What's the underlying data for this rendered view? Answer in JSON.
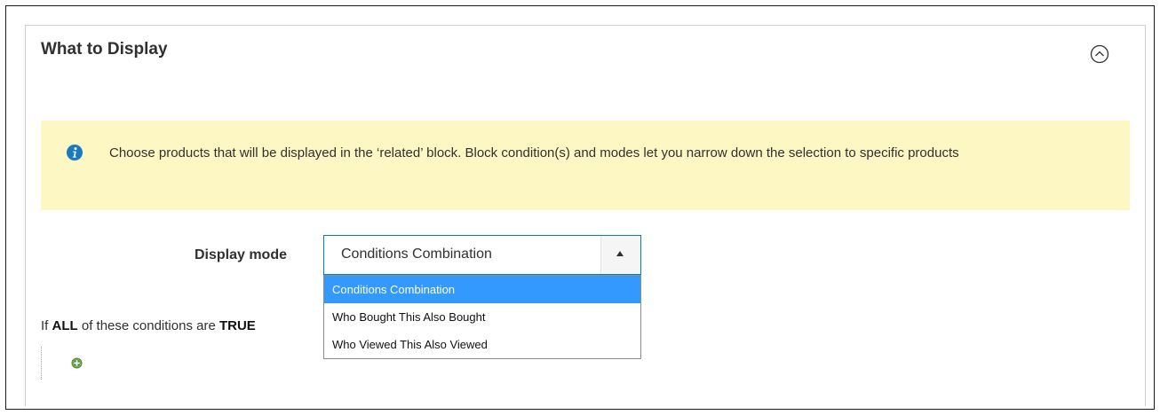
{
  "section": {
    "title": "What to Display",
    "collapse_icon": "chevron-up-circle-icon"
  },
  "notice": {
    "icon": "info-icon",
    "text": "Choose products that will be displayed in the ‘related’ block. Block condition(s) and modes let you narrow down the selection to specific products"
  },
  "display_mode": {
    "label": "Display mode",
    "selected": "Conditions Combination",
    "options": [
      "Conditions Combination",
      "Who Bought This Also Bought",
      "Who Viewed This Also Viewed"
    ]
  },
  "conditions": {
    "prefix": "If",
    "aggregator": "ALL",
    "middle": "of these conditions are",
    "value": "TRUE",
    "add_icon": "add-condition-icon"
  },
  "colors": {
    "notice_bg": "#fdf7c4",
    "info_blue": "#1979c3",
    "select_border": "#007bdb",
    "option_highlight": "#3399ff",
    "add_green": "#4f8b33"
  }
}
